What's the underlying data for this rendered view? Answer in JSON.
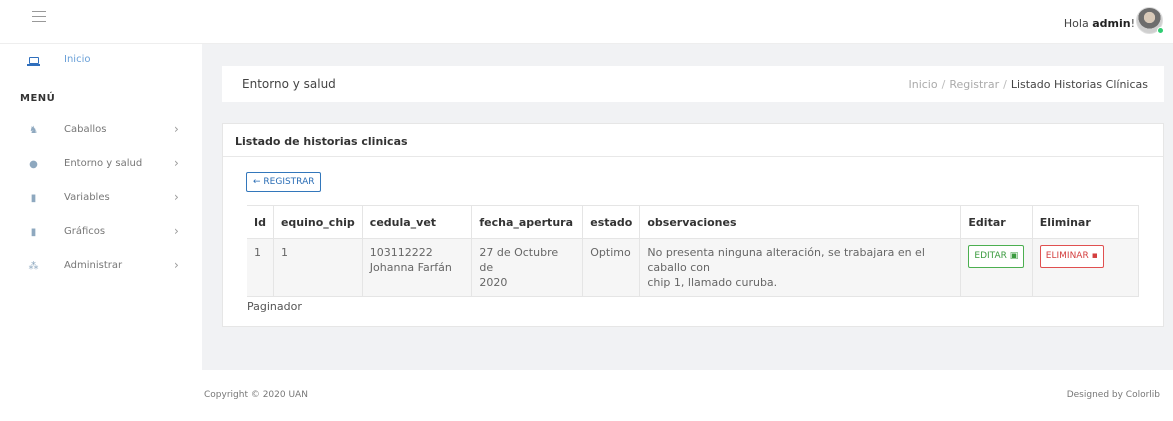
{
  "header": {
    "greeting_prefix": "Hola ",
    "user": "admin",
    "greeting_suffix": "!"
  },
  "sidebar": {
    "home": "Inicio",
    "menu_title": "MENÚ",
    "items": [
      {
        "label": "Caballos",
        "icon": "horse-icon"
      },
      {
        "label": "Entorno y salud",
        "icon": "user-icon"
      },
      {
        "label": "Variables",
        "icon": "file-icon"
      },
      {
        "label": "Gráficos",
        "icon": "file-icon"
      },
      {
        "label": "Administrar",
        "icon": "users-icon"
      }
    ]
  },
  "page": {
    "title": "Entorno y salud",
    "breadcrumb": [
      "Inicio",
      "Registrar",
      "Listado Historias Clínicas"
    ]
  },
  "list": {
    "heading": "Listado de historias clinicas",
    "register_label": "← REGISTRAR",
    "columns": [
      "Id",
      "equino_chip",
      "cedula_vet",
      "fecha_apertura",
      "estado",
      "observaciones",
      "Editar",
      "Eliminar"
    ],
    "rows": [
      {
        "id": "1",
        "equino_chip": "1",
        "cedula_vet_line1": "103112222",
        "cedula_vet_line2": "Johanna Farfán",
        "fecha_line1": "27 de Octubre de",
        "fecha_line2": "2020",
        "estado": "Optimo",
        "obs_line1": "No presenta ninguna alteración, se trabajara en el caballo con",
        "obs_line2": "chip 1, llamado curuba.",
        "edit_label": "EDITAR",
        "delete_label": "ELIMINAR"
      }
    ],
    "paginator": "Paginador"
  },
  "footer": {
    "copyright": "Copyright © 2020 UAN",
    "designed": "Designed by Colorlib"
  },
  "colors": {
    "accent": "#2a6db5",
    "success": "#3b9b3f",
    "danger": "#d43f3f"
  }
}
